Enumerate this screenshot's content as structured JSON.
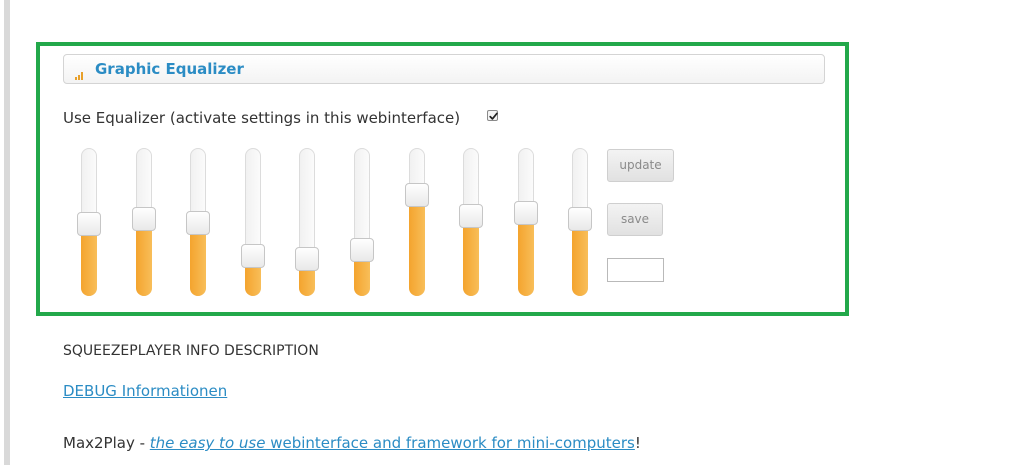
{
  "section": {
    "title": "Graphic Equalizer",
    "icon": "bar-chart-icon"
  },
  "equalizer": {
    "toggle_label": "Use Equalizer (activate settings in this webinterface)",
    "enabled": true,
    "fill_color": "#f5a623",
    "bands": [
      {
        "level": 0.49
      },
      {
        "level": 0.53
      },
      {
        "level": 0.5
      },
      {
        "level": 0.28
      },
      {
        "level": 0.26
      },
      {
        "level": 0.32
      },
      {
        "level": 0.69
      },
      {
        "level": 0.55
      },
      {
        "level": 0.57
      },
      {
        "level": 0.53
      }
    ],
    "update_label": "update",
    "save_label": "save",
    "value_field_text": ""
  },
  "info": {
    "description_title": "SQUEEZEPLAYER INFO DESCRIPTION",
    "debug_link": "DEBUG Informationen"
  },
  "footer": {
    "brand": "Max2Play",
    "separator": " - ",
    "link_italic": "the easy to use",
    "link_rest": " webinterface and framework for mini-computers",
    "trailing": "!"
  },
  "colors": {
    "accent": "#2b8cc4",
    "highlight_border": "#22a84a"
  }
}
